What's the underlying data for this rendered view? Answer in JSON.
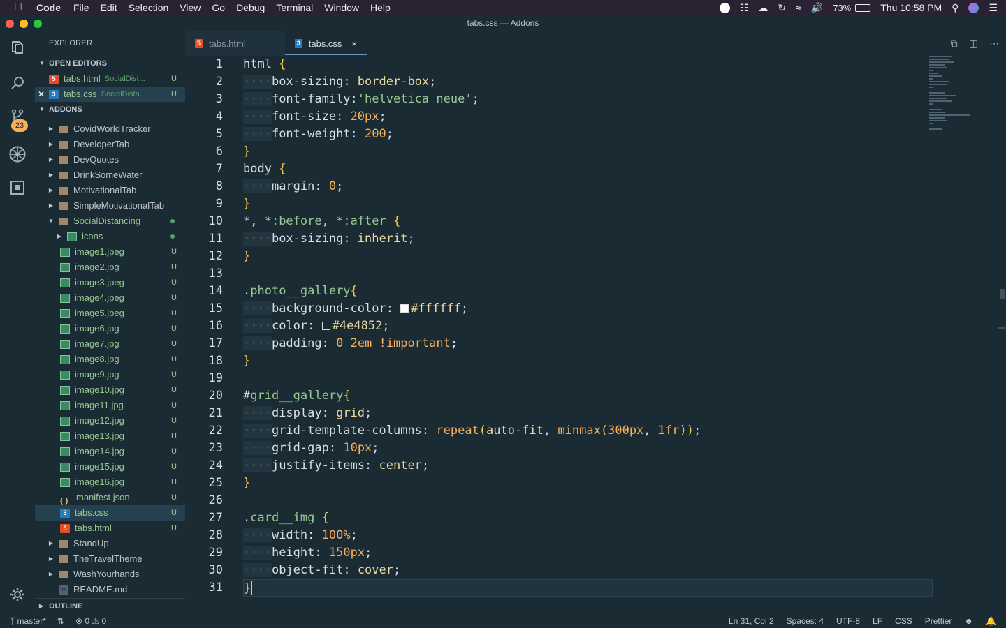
{
  "menubar": {
    "app": "Code",
    "items": [
      "File",
      "Edit",
      "Selection",
      "View",
      "Go",
      "Debug",
      "Terminal",
      "Window",
      "Help"
    ],
    "battery": "73%",
    "clock": "Thu 10:58 PM"
  },
  "window": {
    "title": "tabs.css — Addons"
  },
  "activity": {
    "scm_badge": "23"
  },
  "sidebar": {
    "header": "EXPLORER",
    "open_editors_title": "OPEN EDITORS",
    "open_editors": [
      {
        "name": "tabs.html",
        "path": "SocialDist...",
        "status": "U",
        "type": "html"
      },
      {
        "name": "tabs.css",
        "path": "SocialDista...",
        "status": "U",
        "type": "css"
      }
    ],
    "folder_title": "ADDONS",
    "tree": [
      {
        "name": "CovidWorldTracker",
        "type": "folder"
      },
      {
        "name": "DeveloperTab",
        "type": "folder"
      },
      {
        "name": "DevQuotes",
        "type": "folder"
      },
      {
        "name": "DrinkSomeWater",
        "type": "folder"
      },
      {
        "name": "MotivationalTab",
        "type": "folder"
      },
      {
        "name": "SimpleMotivationalTab",
        "type": "folder"
      },
      {
        "name": "SocialDistancing",
        "type": "folder-open"
      },
      {
        "name": "icons",
        "type": "subfolder"
      },
      {
        "name": "image1.jpeg",
        "type": "img",
        "status": "U"
      },
      {
        "name": "image2.jpg",
        "type": "img",
        "status": "U"
      },
      {
        "name": "image3.jpeg",
        "type": "img",
        "status": "U"
      },
      {
        "name": "image4.jpeg",
        "type": "img",
        "status": "U"
      },
      {
        "name": "image5.jpeg",
        "type": "img",
        "status": "U"
      },
      {
        "name": "image6.jpg",
        "type": "img",
        "status": "U"
      },
      {
        "name": "image7.jpg",
        "type": "img",
        "status": "U"
      },
      {
        "name": "image8.jpg",
        "type": "img",
        "status": "U"
      },
      {
        "name": "image9.jpg",
        "type": "img",
        "status": "U"
      },
      {
        "name": "image10.jpg",
        "type": "img",
        "status": "U"
      },
      {
        "name": "image11.jpg",
        "type": "img",
        "status": "U"
      },
      {
        "name": "image12.jpg",
        "type": "img",
        "status": "U"
      },
      {
        "name": "image13.jpg",
        "type": "img",
        "status": "U"
      },
      {
        "name": "image14.jpg",
        "type": "img",
        "status": "U"
      },
      {
        "name": "image15.jpg",
        "type": "img",
        "status": "U"
      },
      {
        "name": "image16.jpg",
        "type": "img",
        "status": "U"
      },
      {
        "name": "manifest.json",
        "type": "json",
        "status": "U"
      },
      {
        "name": "tabs.css",
        "type": "css",
        "status": "U"
      },
      {
        "name": "tabs.html",
        "type": "html",
        "status": "U"
      },
      {
        "name": "StandUp",
        "type": "folder"
      },
      {
        "name": "TheTravelTheme",
        "type": "folder"
      },
      {
        "name": "WashYourhands",
        "type": "folder"
      },
      {
        "name": "README.md",
        "type": "md"
      }
    ],
    "outline_title": "OUTLINE"
  },
  "tabs": [
    {
      "label": "tabs.html",
      "type": "html"
    },
    {
      "label": "tabs.css",
      "type": "css",
      "close": "×"
    }
  ],
  "code_lines": [
    [
      [
        "sel-t",
        "html"
      ],
      [
        "br",
        " {"
      ]
    ],
    [
      [
        "ind",
        "····"
      ],
      [
        "prop",
        "box-sizing"
      ],
      [
        "",
        "): "
      ],
      [
        "val",
        "border-box"
      ],
      [
        "",
        ";"
      ]
    ],
    [
      [
        "ind",
        "····"
      ],
      [
        "prop",
        "font-family"
      ],
      [
        "",
        ":"
      ],
      [
        "str",
        "'helvetica neue'"
      ],
      [
        "",
        ";"
      ]
    ],
    [
      [
        "ind",
        "····"
      ],
      [
        "prop",
        "font-size"
      ],
      [
        "",
        ": "
      ],
      [
        "num",
        "20"
      ],
      [
        "unit",
        "px"
      ],
      [
        "",
        ";"
      ]
    ],
    [
      [
        "ind",
        "····"
      ],
      [
        "prop",
        "font-weight"
      ],
      [
        "",
        ": "
      ],
      [
        "num",
        "200"
      ],
      [
        "",
        ";"
      ]
    ],
    [
      [
        "br",
        "}"
      ]
    ],
    [
      [
        "sel-t",
        "body"
      ],
      [
        "br",
        " {"
      ]
    ],
    [
      [
        "ind",
        "····"
      ],
      [
        "prop",
        "margin"
      ],
      [
        "",
        ": "
      ],
      [
        "num",
        "0"
      ],
      [
        "",
        ";"
      ]
    ],
    [
      [
        "br",
        "}"
      ]
    ],
    [
      [
        "sel-t",
        "*, *"
      ],
      [
        "pseudo",
        ":before"
      ],
      [
        "",
        ", *"
      ],
      [
        "pseudo",
        ":after"
      ],
      [
        "br",
        " {"
      ]
    ],
    [
      [
        "ind",
        "····"
      ],
      [
        "prop",
        "box-sizing"
      ],
      [
        "",
        ": "
      ],
      [
        "val",
        "inherit"
      ],
      [
        "",
        ";"
      ]
    ],
    [
      [
        "br",
        "}"
      ]
    ],
    [],
    [
      [
        "",
        "."
      ],
      [
        "cls",
        "photo__gallery"
      ],
      [
        "br",
        "{"
      ]
    ],
    [
      [
        "ind",
        "····"
      ],
      [
        "prop",
        "background-color"
      ],
      [
        "",
        ": "
      ],
      [
        "sw-white",
        ""
      ],
      [
        "val",
        "#ffffff"
      ],
      [
        "",
        ";"
      ]
    ],
    [
      [
        "ind",
        "····"
      ],
      [
        "prop",
        "color"
      ],
      [
        "",
        ": "
      ],
      [
        "sw-dark",
        ""
      ],
      [
        "val",
        "#4e4852"
      ],
      [
        "",
        ";"
      ]
    ],
    [
      [
        "ind",
        "····"
      ],
      [
        "prop",
        "padding"
      ],
      [
        "",
        ": "
      ],
      [
        "num",
        "0 2"
      ],
      [
        "unit",
        "em"
      ],
      [
        "kw",
        " !important"
      ],
      [
        "",
        ";"
      ]
    ],
    [
      [
        "br",
        "}"
      ]
    ],
    [],
    [
      [
        "",
        "#"
      ],
      [
        "cls",
        "grid__gallery"
      ],
      [
        "br",
        "{"
      ]
    ],
    [
      [
        "ind",
        "····"
      ],
      [
        "prop",
        "display"
      ],
      [
        "",
        ": "
      ],
      [
        "val",
        "grid"
      ],
      [
        "",
        ";"
      ]
    ],
    [
      [
        "ind",
        "····"
      ],
      [
        "prop",
        "grid-template-columns"
      ],
      [
        "",
        ": "
      ],
      [
        "fn",
        "repeat"
      ],
      [
        "br",
        "("
      ],
      [
        "val",
        "auto-fit"
      ],
      [
        "",
        ", "
      ],
      [
        "fn",
        "minmax"
      ],
      [
        "br",
        "("
      ],
      [
        "num",
        "300"
      ],
      [
        "unit",
        "px"
      ],
      [
        "",
        ", "
      ],
      [
        "num",
        "1"
      ],
      [
        "unit",
        "fr"
      ],
      [
        "br",
        "))"
      ],
      [
        "",
        ";"
      ]
    ],
    [
      [
        "ind",
        "····"
      ],
      [
        "prop",
        "grid-gap"
      ],
      [
        "",
        ": "
      ],
      [
        "num",
        "10"
      ],
      [
        "unit",
        "px"
      ],
      [
        "",
        ";"
      ]
    ],
    [
      [
        "ind",
        "····"
      ],
      [
        "prop",
        "justify-items"
      ],
      [
        "",
        ": "
      ],
      [
        "val",
        "center"
      ],
      [
        "",
        ";"
      ]
    ],
    [
      [
        "br",
        "}"
      ]
    ],
    [],
    [
      [
        "",
        "."
      ],
      [
        "cls",
        "card__img"
      ],
      [
        "br",
        " {"
      ]
    ],
    [
      [
        "ind",
        "····"
      ],
      [
        "prop",
        "width"
      ],
      [
        "",
        ": "
      ],
      [
        "num",
        "100"
      ],
      [
        "unit",
        "%"
      ],
      [
        "",
        ";"
      ]
    ],
    [
      [
        "ind",
        "····"
      ],
      [
        "prop",
        "height"
      ],
      [
        "",
        ": "
      ],
      [
        "num",
        "150"
      ],
      [
        "unit",
        "px"
      ],
      [
        "",
        ";"
      ]
    ],
    [
      [
        "ind",
        "····"
      ],
      [
        "prop",
        "object-fit"
      ],
      [
        "",
        ": "
      ],
      [
        "val",
        "cover"
      ],
      [
        "",
        ";"
      ]
    ],
    [
      [
        "br",
        "}"
      ]
    ]
  ],
  "status": {
    "branch": "master*",
    "errors": "0",
    "warnings": "0",
    "position": "Ln 31, Col 2",
    "spaces": "Spaces: 4",
    "encoding": "UTF-8",
    "eol": "LF",
    "language": "CSS",
    "formatter": "Prettier"
  },
  "colors": {
    "accent": "#6699cc",
    "bg": "#1b2b34",
    "untracked": "#99c794",
    "badge": "#f9ae58"
  }
}
